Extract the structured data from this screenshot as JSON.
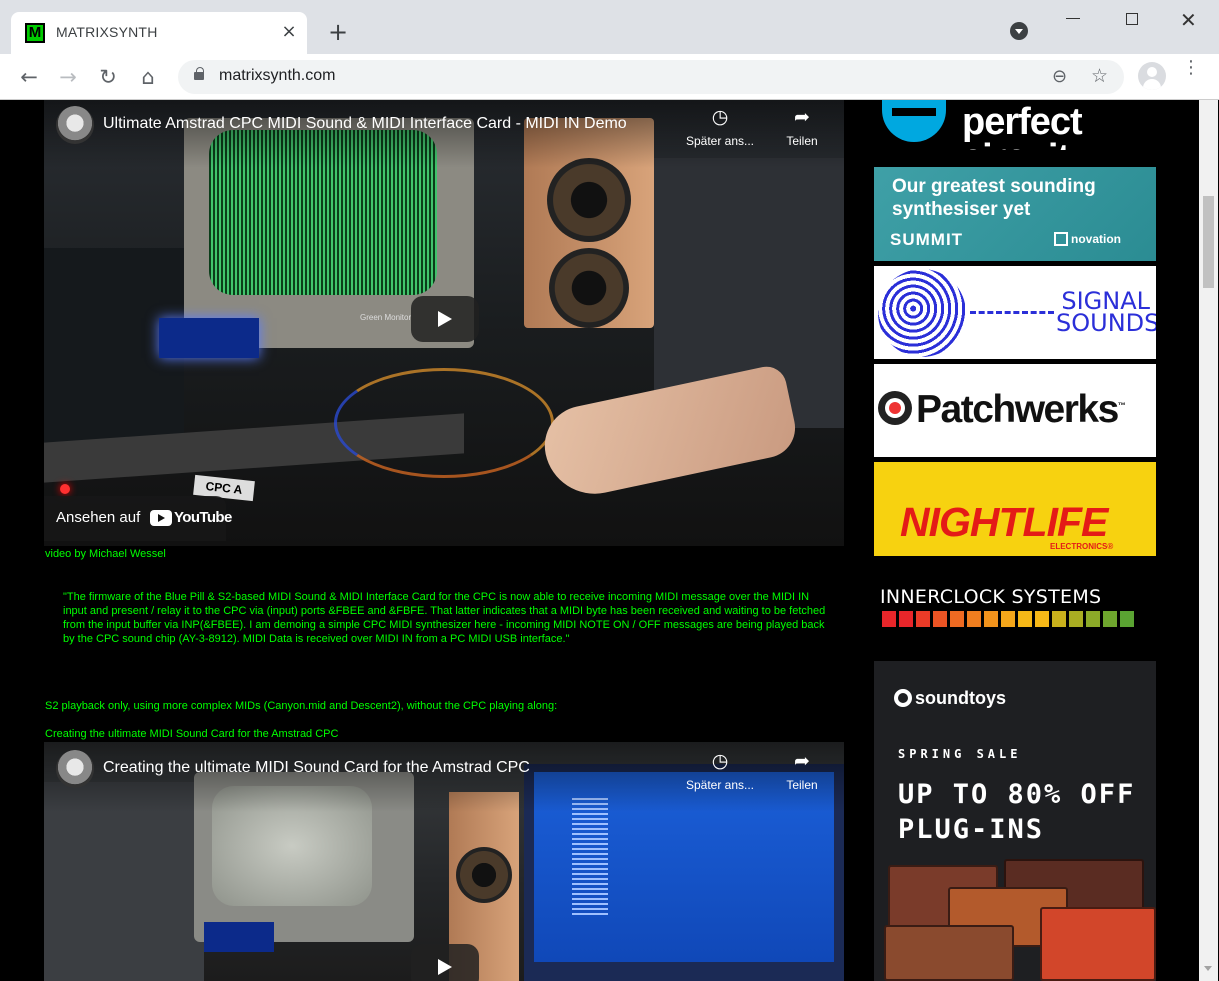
{
  "browser": {
    "tab_title": "MATRIXSYNTH",
    "favicon_letter": "M",
    "tab_close_icon": "×",
    "new_tab_icon": "+",
    "url": "matrixsynth.com"
  },
  "icons": {
    "back": "←",
    "forward": "→",
    "reload": "↻",
    "home": "⌂",
    "zoom": "⊖",
    "star": "☆",
    "menu": "⋮",
    "clock": "◷",
    "share": "➦",
    "window_close": "✕"
  },
  "video1": {
    "title": "Ultimate Amstrad CPC MIDI Sound & MIDI Interface Card - MIDI IN Demo",
    "watch_later": "Später ans...",
    "share": "Teilen",
    "watch_on": "Ansehen auf",
    "youtube": "YouTube",
    "scene_label": "CPC A",
    "monitor_label": "Green Monitor"
  },
  "post": {
    "credit": "video by Michael Wessel",
    "quote": "\"The firmware of the Blue Pill & S2-based MIDI Sound & MIDI Interface Card for the CPC is now able to receive incoming MIDI message over the MIDI IN input and present / relay it to the CPC via (input) ports &FBEE and &FBFE. That latter indicates that a MIDI byte has been received and waiting to be fetched from the input buffer via INP(&FBEE). I am demoing a simple CPC MIDI synthesizer here - incoming MIDI NOTE ON / OFF messages are being played back by the CPC sound chip (AY-3-8912). MIDI Data is received over MIDI IN from a PC MIDI USB interface.\"",
    "s2_line": "S2 playback only, using more complex MIDs (Canyon.mid and Descent2), without the CPC playing along:",
    "video2_caption": "Creating the ultimate MIDI Sound Card for the Amstrad CPC"
  },
  "video2": {
    "title": "Creating the ultimate MIDI Sound Card for the Amstrad CPC",
    "watch_later": "Später ans...",
    "share": "Teilen"
  },
  "ads": {
    "perfect_circuit": "perfect circuit",
    "summit_headline": "Our greatest sounding synthesiser yet",
    "summit_brand": "SUMMIT",
    "novation": "novation",
    "signal_sounds": "SIGNAL SOUNDS",
    "patchwerks": "Patchwerks",
    "patchwerks_tm": "™",
    "nightlife": "NIGHTLIFE",
    "nightlife_sub": "ELECTRONICS®",
    "innerclock": "INNERCLOCK SYSTEMS",
    "innerclock_colors": [
      "#e8262a",
      "#e8262a",
      "#ea3b27",
      "#ec5424",
      "#ee6a22",
      "#f07e1f",
      "#f2931c",
      "#f4a61a",
      "#f6b817",
      "#f6b817",
      "#c9b11c",
      "#a9ad22",
      "#8caa28",
      "#6fa62e",
      "#5aa332"
    ],
    "soundtoys_logo": "soundtoys",
    "soundtoys_spring": "SPRING SALE",
    "soundtoys_headline": "UP TO 80% OFF PLUG-INS"
  },
  "colors": {
    "page_bg": "#000000",
    "text_green": "#00ff00",
    "signal_blue": "#2b2fd8",
    "nightlife_yellow": "#f7d210",
    "nightlife_red": "#e41b17",
    "summit_teal": "#3fa0a7",
    "perfect_circuit_blue": "#00a8e0"
  }
}
